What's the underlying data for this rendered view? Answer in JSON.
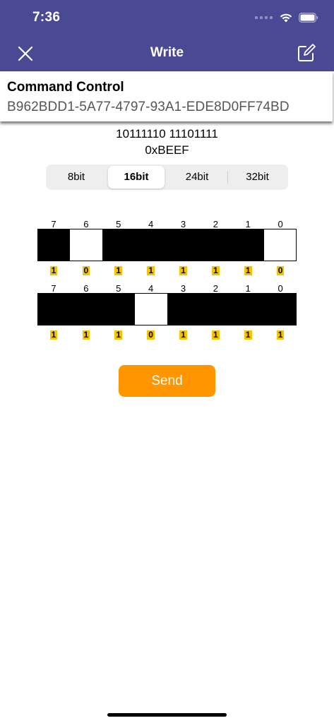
{
  "status_bar": {
    "time": "7:36"
  },
  "nav": {
    "title": "Write",
    "left_icon": "close-icon",
    "right_icon": "compose-icon"
  },
  "characteristic": {
    "name": "Command Control",
    "uuid": "B962BDD1-5A77-4797-93A1-EDE8D0FF74BD"
  },
  "value": {
    "binary": "10111110 11101111",
    "hex": "0xBEEF"
  },
  "bit_width": {
    "options": [
      "8bit",
      "16bit",
      "24bit",
      "32bit"
    ],
    "selected": "16bit"
  },
  "bytes": [
    {
      "indices": [
        "7",
        "6",
        "5",
        "4",
        "3",
        "2",
        "1",
        "0"
      ],
      "bits": [
        "1",
        "0",
        "1",
        "1",
        "1",
        "1",
        "1",
        "0"
      ]
    },
    {
      "indices": [
        "7",
        "6",
        "5",
        "4",
        "3",
        "2",
        "1",
        "0"
      ],
      "bits": [
        "1",
        "1",
        "1",
        "0",
        "1",
        "1",
        "1",
        "1"
      ]
    }
  ],
  "send_label": "Send",
  "colors": {
    "nav_background": "#4a4a94",
    "accent": "#ff9500",
    "bit_on": "#000000",
    "bit_off": "#ffffff",
    "bit_label_background": "#f5c400"
  }
}
